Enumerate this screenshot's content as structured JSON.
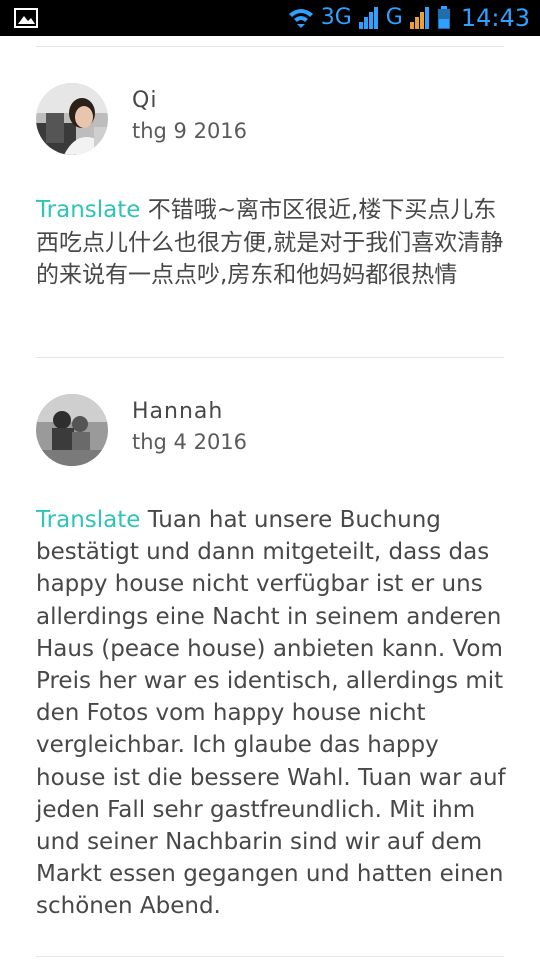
{
  "status_bar": {
    "network_1": "3G",
    "network_2": "G",
    "time": "14:43",
    "icons": [
      "image-icon",
      "wifi-icon",
      "signal-icon",
      "battery-icon"
    ],
    "accent_color": "#2ea0ff"
  },
  "reviews": [
    {
      "name": "Qi",
      "date": "thg 9 2016",
      "translate_label": "Translate",
      "text": "不错哦~离市区很近,楼下买点儿东西吃点儿什么也很方便,就是对于我们喜欢清静的来说有一点点吵,房东和他妈妈都很热情"
    },
    {
      "name": "Hannah",
      "date": "thg 4 2016",
      "translate_label": "Translate",
      "text": "Tuan hat unsere Buchung bestätigt und dann mitgeteilt, dass das happy house nicht verfügbar ist er uns allerdings eine Nacht in seinem anderen Haus (peace house) anbieten kann. Vom Preis her war es identisch, allerdings mit den Fotos vom happy house nicht vergleichbar. Ich glaube das happy house ist die bessere Wahl. Tuan war auf jeden Fall sehr gastfreundlich. Mit ihm und seiner Nachbarin sind wir auf dem Markt essen gegangen und hatten einen schönen Abend."
    }
  ],
  "colors": {
    "translate": "#2ec4b6",
    "text": "#484848"
  }
}
